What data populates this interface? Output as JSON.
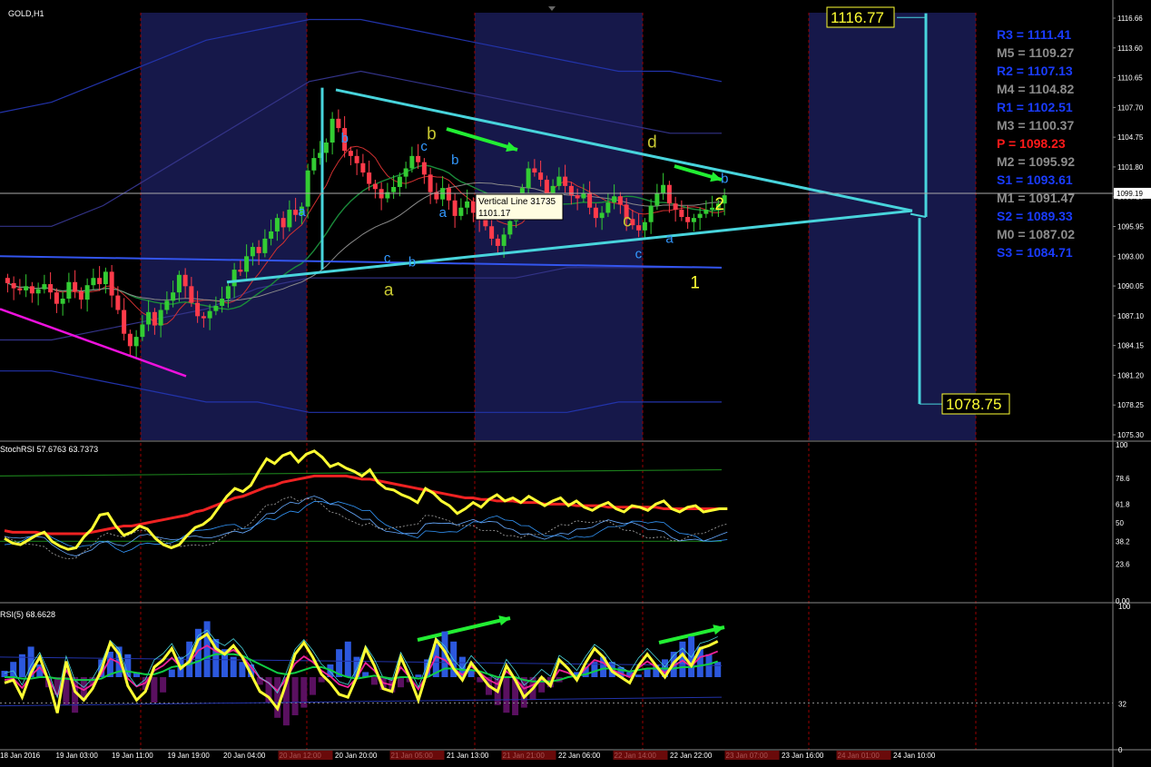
{
  "window": {
    "title": "GOLD,H1"
  },
  "colors": {
    "background": "#000000",
    "shade": "#16184a",
    "bull": "#33cc33",
    "bear": "#ff3b4a",
    "triangle": "#48d4dc",
    "fib_yellow": "#ffff33",
    "wave_blue": "#3399ff",
    "wave_yellow": "#c8c832",
    "arrow": "#22ee33",
    "magenta": "#ee11dd",
    "grid": "#9a0000",
    "pivot_blue": "#1a3cff",
    "pivot_gray": "#8c8c8c",
    "pivot_red": "#ff1a1a"
  },
  "chart_data": [
    {
      "type": "candlestick",
      "panel": "price",
      "symbol": "GOLD",
      "timeframe": "H1",
      "ylim": [
        1075.3,
        1116.66
      ],
      "y_ticks": [
        "1116.66",
        "1113.60",
        "1110.65",
        "1107.70",
        "1104.75",
        "1101.80",
        "1099.19",
        "1095.95",
        "1093.00",
        "1090.05",
        "1087.10",
        "1084.15",
        "1081.20",
        "1078.25",
        "1075.30"
      ],
      "current_price": "1099.19",
      "x_labels": [
        "18 Jan 2016",
        "19 Jan 03:00",
        "19 Jan 11:00",
        "19 Jan 19:00",
        "20 Jan 04:00",
        "20 Jan 12:00",
        "20 Jan 20:00",
        "21 Jan 05:00",
        "21 Jan 13:00",
        "21 Jan 21:00",
        "22 Jan 06:00",
        "22 Jan 14:00",
        "22 Jan 22:00",
        "23 Jan 07:00",
        "23 Jan 16:00",
        "24 Jan 01:00",
        "24 Jan 10:00"
      ],
      "closes": [
        1090.5,
        1090.0,
        1089.8,
        1090.2,
        1089.5,
        1089.9,
        1090.4,
        1089.6,
        1088.5,
        1089.0,
        1090.6,
        1089.7,
        1088.9,
        1090.3,
        1091.0,
        1090.4,
        1091.6,
        1089.3,
        1087.9,
        1085.6,
        1084.4,
        1085.3,
        1086.5,
        1087.7,
        1086.4,
        1087.9,
        1088.8,
        1089.6,
        1091.3,
        1090.2,
        1088.6,
        1087.3,
        1087.1,
        1087.8,
        1088.3,
        1089.0,
        1090.2,
        1091.8,
        1091.6,
        1093.1,
        1094.0,
        1093.4,
        1094.8,
        1095.5,
        1096.8,
        1095.9,
        1097.6,
        1097.1,
        1097.9,
        1101.4,
        1102.6,
        1103.1,
        1104.1,
        1106.4,
        1105.5,
        1103.3,
        1102.8,
        1102.1,
        1101.2,
        1100.1,
        1099.6,
        1098.7,
        1099.3,
        1099.8,
        1100.8,
        1101.6,
        1102.8,
        1102.2,
        1101.0,
        1099.3,
        1098.6,
        1099.7,
        1098.5,
        1097.0,
        1097.8,
        1098.4,
        1097.3,
        1096.6,
        1096.0,
        1094.8,
        1094.1,
        1095.2,
        1096.5,
        1097.9,
        1099.7,
        1101.6,
        1101.2,
        1100.5,
        1099.2,
        1099.9,
        1100.8,
        1099.9,
        1099.0,
        1098.7,
        1099.2,
        1097.8,
        1096.8,
        1097.3,
        1098.3,
        1098.9,
        1098.1,
        1096.7,
        1096.1,
        1095.6,
        1096.4,
        1098.0,
        1099.2,
        1100.0,
        1098.2,
        1097.6,
        1096.9,
        1096.4,
        1096.8,
        1097.2,
        1097.6,
        1097.8,
        1098.2,
        1099.0
      ],
      "annotations": {
        "triangle_top_label": "1116.77",
        "triangle_bottom_label": "1078.75",
        "tooltip_title": "Vertical Line 31735",
        "tooltip_value": "1101.17",
        "wave_labels": [
          {
            "text": "a",
            "color": "wave_yellow",
            "price": 1089.3,
            "bar": 62
          },
          {
            "text": "b",
            "color": "wave_yellow",
            "price": 1104.4,
            "bar": 69
          },
          {
            "text": "c",
            "color": "wave_yellow",
            "price": 1096.0,
            "bar": 101
          },
          {
            "text": "d",
            "color": "wave_yellow",
            "price": 1103.6,
            "bar": 105
          },
          {
            "text": "1",
            "color": "fib_yellow",
            "price": 1090.0,
            "bar": 112
          },
          {
            "text": "2",
            "color": "fib_yellow",
            "price": 1097.6,
            "bar": 116
          },
          {
            "text": "b",
            "color": "wave_blue",
            "price": 1104.1,
            "bar": 55
          },
          {
            "text": "a",
            "color": "wave_blue",
            "price": 1097.0,
            "bar": 48
          },
          {
            "text": "c",
            "color": "wave_blue",
            "price": 1103.3,
            "bar": 68
          },
          {
            "text": "c",
            "color": "wave_blue",
            "price": 1092.5,
            "bar": 62
          },
          {
            "text": "b",
            "color": "wave_blue",
            "price": 1092.1,
            "bar": 66
          },
          {
            "text": "b",
            "color": "wave_blue",
            "price": 1102.0,
            "bar": 73
          },
          {
            "text": "a",
            "color": "wave_blue",
            "price": 1096.9,
            "bar": 71
          },
          {
            "text": "c",
            "color": "wave_blue",
            "price": 1092.9,
            "bar": 103
          },
          {
            "text": "a",
            "color": "wave_blue",
            "price": 1094.4,
            "bar": 108
          },
          {
            "text": "b",
            "color": "wave_blue",
            "price": 1100.2,
            "bar": 117
          }
        ]
      },
      "pivots": [
        {
          "label": "R3",
          "value": "1111.41",
          "color": "pivot_blue"
        },
        {
          "label": "M5",
          "value": "1109.27",
          "color": "pivot_gray"
        },
        {
          "label": "R2",
          "value": "1107.13",
          "color": "pivot_blue"
        },
        {
          "label": "M4",
          "value": "1104.82",
          "color": "pivot_gray"
        },
        {
          "label": "R1",
          "value": "1102.51",
          "color": "pivot_blue"
        },
        {
          "label": "M3",
          "value": "1100.37",
          "color": "pivot_gray"
        },
        {
          "label": "P ",
          "value": "1098.23",
          "color": "pivot_red"
        },
        {
          "label": "M2",
          "value": "1095.92",
          "color": "pivot_gray"
        },
        {
          "label": "S1",
          "value": "1093.61",
          "color": "pivot_blue"
        },
        {
          "label": "M1",
          "value": "1091.47",
          "color": "pivot_gray"
        },
        {
          "label": "S2",
          "value": "1089.33",
          "color": "pivot_blue"
        },
        {
          "label": "M0",
          "value": "1087.02",
          "color": "pivot_gray"
        },
        {
          "label": "S3",
          "value": "1084.71",
          "color": "pivot_blue"
        }
      ],
      "grid": true
    },
    {
      "type": "line",
      "panel": "stochrsi",
      "title": "StochRSI 57.6763 63.7373",
      "ylim": [
        0,
        100
      ],
      "y_ticks": [
        "100",
        "78.6",
        "61.8",
        "50",
        "38.2",
        "23.6",
        "0.00"
      ],
      "series": [
        {
          "name": "main",
          "color": "#ffff33",
          "values": [
            40,
            37,
            36,
            39,
            42,
            44,
            38,
            35,
            33,
            34,
            41,
            46,
            55,
            56,
            48,
            42,
            44,
            48,
            46,
            40,
            36,
            34,
            36,
            42,
            47,
            49,
            53,
            60,
            67,
            72,
            70,
            74,
            83,
            91,
            88,
            93,
            95,
            89,
            94,
            96,
            92,
            86,
            88,
            85,
            83,
            80,
            84,
            76,
            72,
            71,
            68,
            66,
            63,
            72,
            69,
            64,
            61,
            56,
            59,
            63,
            60,
            65,
            68,
            64,
            66,
            63,
            67,
            64,
            61,
            64,
            66,
            61,
            64,
            60,
            58,
            61,
            63,
            59,
            57,
            61,
            60,
            58,
            62,
            64,
            59,
            57,
            60,
            61,
            57,
            58,
            59,
            59
          ]
        },
        {
          "name": "signal",
          "color": "#ee2222",
          "values": [
            45,
            44,
            44,
            44,
            44,
            43,
            43,
            43,
            43,
            43,
            43,
            44,
            45,
            46,
            47,
            48,
            48,
            49,
            50,
            51,
            52,
            53,
            54,
            55,
            57,
            58,
            60,
            62,
            64,
            66,
            67,
            69,
            71,
            73,
            74,
            76,
            77,
            78,
            79,
            80,
            80,
            80,
            80,
            80,
            79,
            78,
            78,
            77,
            76,
            75,
            74,
            73,
            72,
            71,
            70,
            69,
            68,
            67,
            66,
            66,
            65,
            65,
            64,
            64,
            64,
            63,
            63,
            63,
            62,
            62,
            62,
            62,
            61,
            61,
            61,
            61,
            60,
            60,
            60,
            60,
            60,
            60,
            60,
            59,
            59,
            59,
            59,
            59,
            59,
            59,
            59,
            59
          ]
        }
      ]
    },
    {
      "type": "bar+line",
      "panel": "rsi",
      "title": "RSI(5) 68.6628",
      "ylim": [
        0,
        100
      ],
      "y_ticks": [
        "100",
        "32",
        "0"
      ],
      "histogram": [
        5,
        12,
        18,
        24,
        10,
        -8,
        -14,
        -22,
        -28,
        -18,
        -6,
        14,
        20,
        24,
        18,
        4,
        -10,
        -20,
        -12,
        6,
        16,
        28,
        38,
        44,
        30,
        22,
        16,
        12,
        10,
        -6,
        -20,
        -32,
        -38,
        -30,
        -24,
        -14,
        -4,
        10,
        22,
        28,
        16,
        4,
        -6,
        -10,
        -12,
        -8,
        -4,
        2,
        14,
        26,
        36,
        28,
        16,
        6,
        -4,
        -14,
        -22,
        -28,
        -30,
        -24,
        -18,
        -12,
        -8,
        -4,
        0,
        4,
        8,
        12,
        16,
        12,
        8,
        4,
        2,
        6,
        10,
        14,
        20,
        28,
        32,
        24,
        18,
        12
      ],
      "series": [
        {
          "name": "rsi",
          "color": "#ffff33",
          "values": [
            46,
            48,
            36,
            53,
            64,
            47,
            25,
            61,
            40,
            34,
            42,
            55,
            74,
            66,
            44,
            34,
            40,
            57,
            62,
            70,
            56,
            61,
            76,
            80,
            70,
            66,
            72,
            64,
            52,
            40,
            36,
            28,
            46,
            66,
            74,
            64,
            52,
            46,
            38,
            36,
            50,
            70,
            58,
            42,
            40,
            64,
            50,
            34,
            54,
            76,
            68,
            56,
            48,
            60,
            52,
            44,
            40,
            58,
            48,
            36,
            42,
            50,
            44,
            62,
            56,
            48,
            60,
            70,
            64,
            54,
            50,
            46,
            58,
            66,
            58,
            50,
            60,
            66,
            58,
            70,
            72,
            75
          ]
        },
        {
          "name": "ma",
          "color": "#11cc44",
          "values": [
            50,
            50,
            49,
            49,
            50,
            50,
            49,
            49,
            48,
            48,
            48,
            49,
            52,
            54,
            54,
            53,
            52,
            52,
            54,
            57,
            58,
            59,
            61,
            64,
            66,
            66,
            66,
            65,
            62,
            59,
            56,
            53,
            52,
            53,
            55,
            57,
            57,
            55,
            52,
            50,
            49,
            50,
            51,
            50,
            49,
            50,
            50,
            49,
            50,
            53,
            56,
            56,
            55,
            55,
            54,
            52,
            50,
            50,
            50,
            48,
            47,
            47,
            47,
            48,
            50,
            51,
            52,
            54,
            56,
            56,
            55,
            54,
            55,
            56,
            56,
            56,
            56,
            57,
            57,
            58,
            59,
            61
          ]
        }
      ]
    }
  ]
}
